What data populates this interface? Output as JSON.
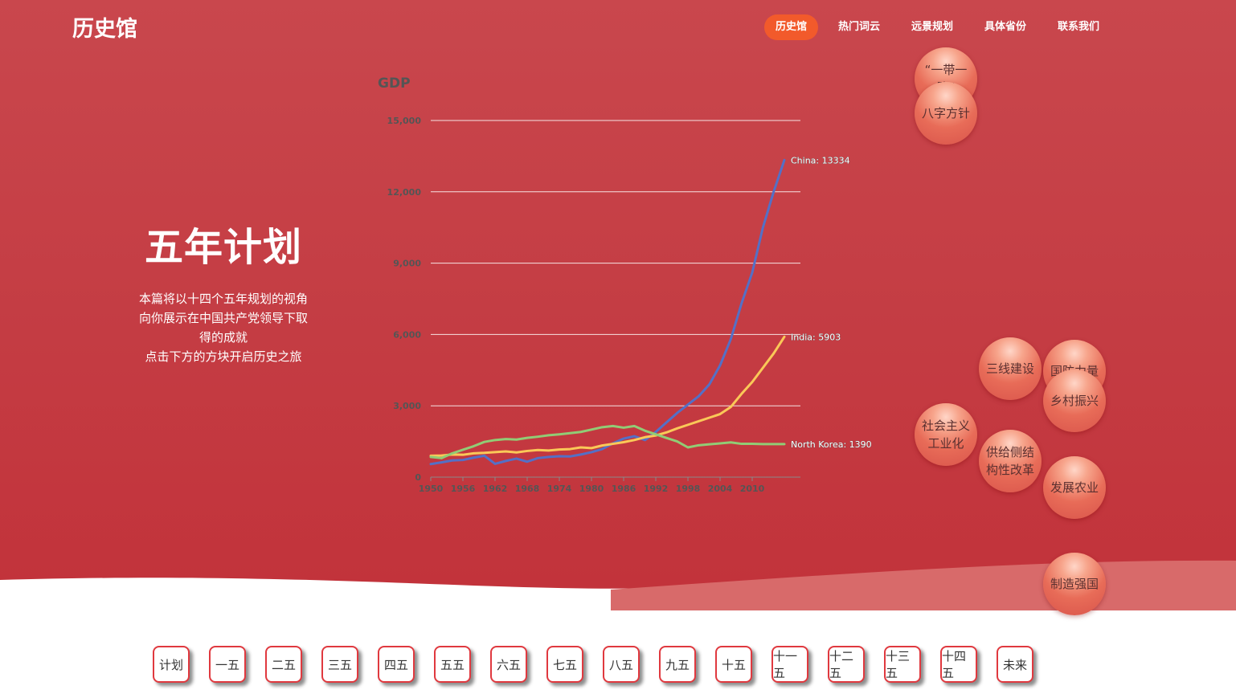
{
  "brand": "历史馆",
  "nav": [
    {
      "label": "历史馆",
      "active": true
    },
    {
      "label": "热门词云",
      "active": false
    },
    {
      "label": "远景规划",
      "active": false
    },
    {
      "label": "具体省份",
      "active": false
    },
    {
      "label": "联系我们",
      "active": false
    }
  ],
  "hero": {
    "title": "五年计划",
    "desc": [
      "本篇将以十四个五年规划的视角",
      "向你展示在中国共产党领导下取",
      "得的成就",
      "点击下方的方块开启历史之旅"
    ]
  },
  "bubbles": [
    {
      "label": "“一带一路”"
    },
    {
      "label": "八字方针"
    },
    {
      "label": "三线建设"
    },
    {
      "label": "国防力量"
    },
    {
      "label": "乡村振兴"
    },
    {
      "label": "社会主义工业化"
    },
    {
      "label": "供给侧结构性改革"
    },
    {
      "label": "发展农业"
    },
    {
      "label": "制造强国"
    }
  ],
  "plans": [
    "计划",
    "一五",
    "二五",
    "三五",
    "四五",
    "五五",
    "六五",
    "七五",
    "八五",
    "九五",
    "十五",
    "十一五",
    "十二五",
    "十三五",
    "十四五",
    "未来"
  ],
  "colors": {
    "china": "#5470c6",
    "india": "#fac858",
    "north_korea": "#91cc75",
    "nav_active": "#f25a2b",
    "hero": "#c43c43"
  },
  "chart_data": {
    "type": "line",
    "title": "",
    "ylabel": "GDP",
    "xlabel": "",
    "ylim": [
      0,
      15000
    ],
    "yticks": [
      "0",
      "3,000",
      "6,000",
      "9,000",
      "12,000",
      "15,000"
    ],
    "xticks": [
      "1950",
      "1956",
      "1962",
      "1968",
      "1974",
      "1980",
      "1986",
      "1992",
      "1998",
      "2004",
      "2010"
    ],
    "grid": true,
    "x": [
      1950,
      1952,
      1954,
      1956,
      1958,
      1960,
      1962,
      1964,
      1966,
      1968,
      1970,
      1972,
      1974,
      1976,
      1978,
      1980,
      1982,
      1984,
      1986,
      1988,
      1990,
      1992,
      1994,
      1996,
      1998,
      2000,
      2002,
      2004,
      2006,
      2008,
      2010,
      2012,
      2014,
      2016
    ],
    "series": [
      {
        "name": "China",
        "end_label": "China: 13334",
        "values": [
          550,
          620,
          700,
          720,
          820,
          900,
          560,
          680,
          780,
          650,
          800,
          850,
          880,
          870,
          950,
          1050,
          1180,
          1420,
          1620,
          1720,
          1560,
          1900,
          2300,
          2700,
          3050,
          3400,
          3900,
          4700,
          5800,
          7300,
          8600,
          10500,
          12000,
          13334
        ]
      },
      {
        "name": "India",
        "end_label": "India: 5903",
        "values": [
          900,
          910,
          950,
          940,
          1000,
          1020,
          1050,
          1080,
          1040,
          1100,
          1140,
          1120,
          1160,
          1180,
          1250,
          1220,
          1330,
          1400,
          1470,
          1560,
          1680,
          1750,
          1880,
          2050,
          2200,
          2350,
          2500,
          2650,
          2950,
          3500,
          4000,
          4600,
          5200,
          5903
        ]
      },
      {
        "name": "North Korea",
        "end_label": "North Korea: 1390",
        "values": [
          850,
          800,
          1000,
          1150,
          1300,
          1480,
          1560,
          1600,
          1580,
          1650,
          1700,
          1760,
          1800,
          1850,
          1900,
          2000,
          2100,
          2150,
          2080,
          2150,
          1950,
          1800,
          1650,
          1500,
          1250,
          1340,
          1380,
          1420,
          1460,
          1400,
          1400,
          1390,
          1390,
          1390
        ]
      }
    ]
  }
}
